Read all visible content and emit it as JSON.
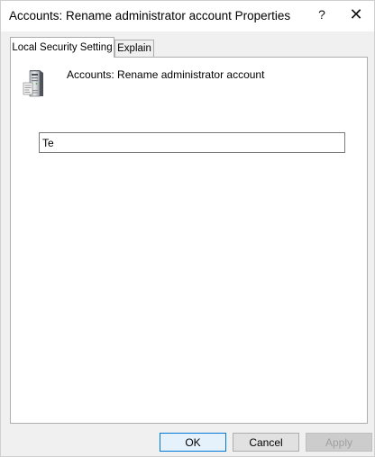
{
  "window": {
    "title": "Accounts: Rename administrator account Properties",
    "help_label": "?",
    "close_label": "✕"
  },
  "tabs": [
    {
      "label": "Local Security Setting",
      "active": true
    },
    {
      "label": "Explain",
      "active": false
    }
  ],
  "policy": {
    "icon": "server-policy-icon",
    "name": "Accounts: Rename administrator account"
  },
  "input": {
    "value": "Te"
  },
  "buttons": {
    "ok": "OK",
    "cancel": "Cancel",
    "apply": "Apply"
  }
}
